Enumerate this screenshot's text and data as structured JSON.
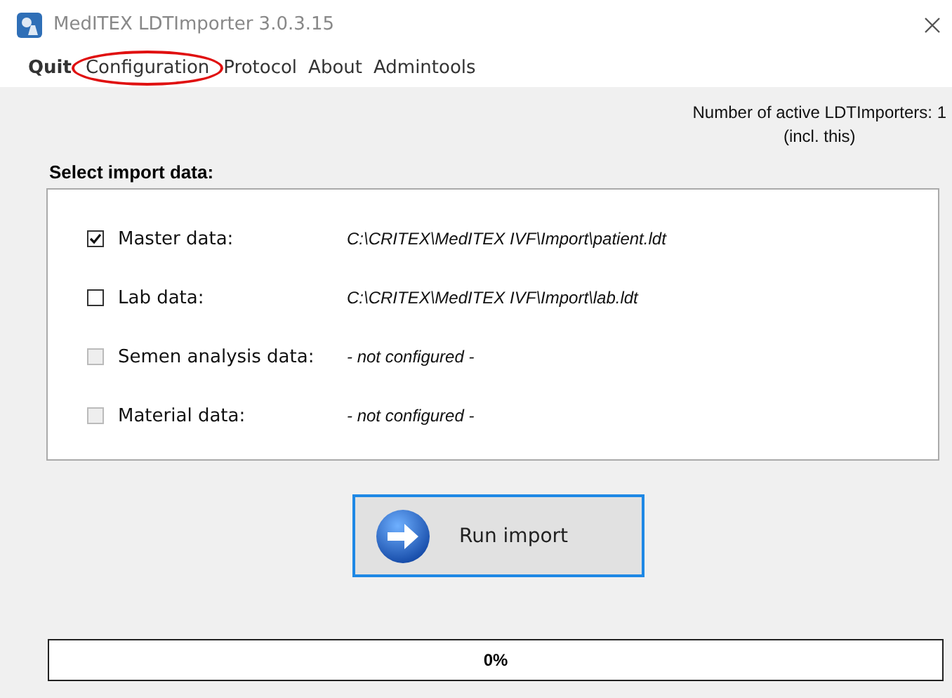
{
  "window": {
    "title": "MedITEX LDTImporter 3.0.3.15"
  },
  "menu": [
    {
      "label": "Quit",
      "bold": true,
      "circled": false
    },
    {
      "label": "Configuration",
      "bold": false,
      "circled": true
    },
    {
      "label": "Protocol",
      "bold": false,
      "circled": false
    },
    {
      "label": "About",
      "bold": false,
      "circled": false
    },
    {
      "label": "Admintools",
      "bold": false,
      "circled": false
    }
  ],
  "active_info": [
    "Number of active LDTImporters: 1",
    "(incl. this)"
  ],
  "import_section": {
    "title": "Select import data:",
    "items": [
      {
        "label": "Master data:",
        "path": "C:\\CRITEX\\MedITEX IVF\\Import\\patient.ldt",
        "checked": true,
        "disabled": false
      },
      {
        "label": "Lab data:",
        "path": "C:\\CRITEX\\MedITEX IVF\\Import\\lab.ldt",
        "checked": false,
        "disabled": false
      },
      {
        "label": "Semen analysis data:",
        "path": "- not configured -",
        "checked": false,
        "disabled": true
      },
      {
        "label": "Material data:",
        "path": "- not configured -",
        "checked": false,
        "disabled": true
      }
    ]
  },
  "run_button": {
    "label": "Run import"
  },
  "progress": {
    "level": 0,
    "label": "0%"
  }
}
